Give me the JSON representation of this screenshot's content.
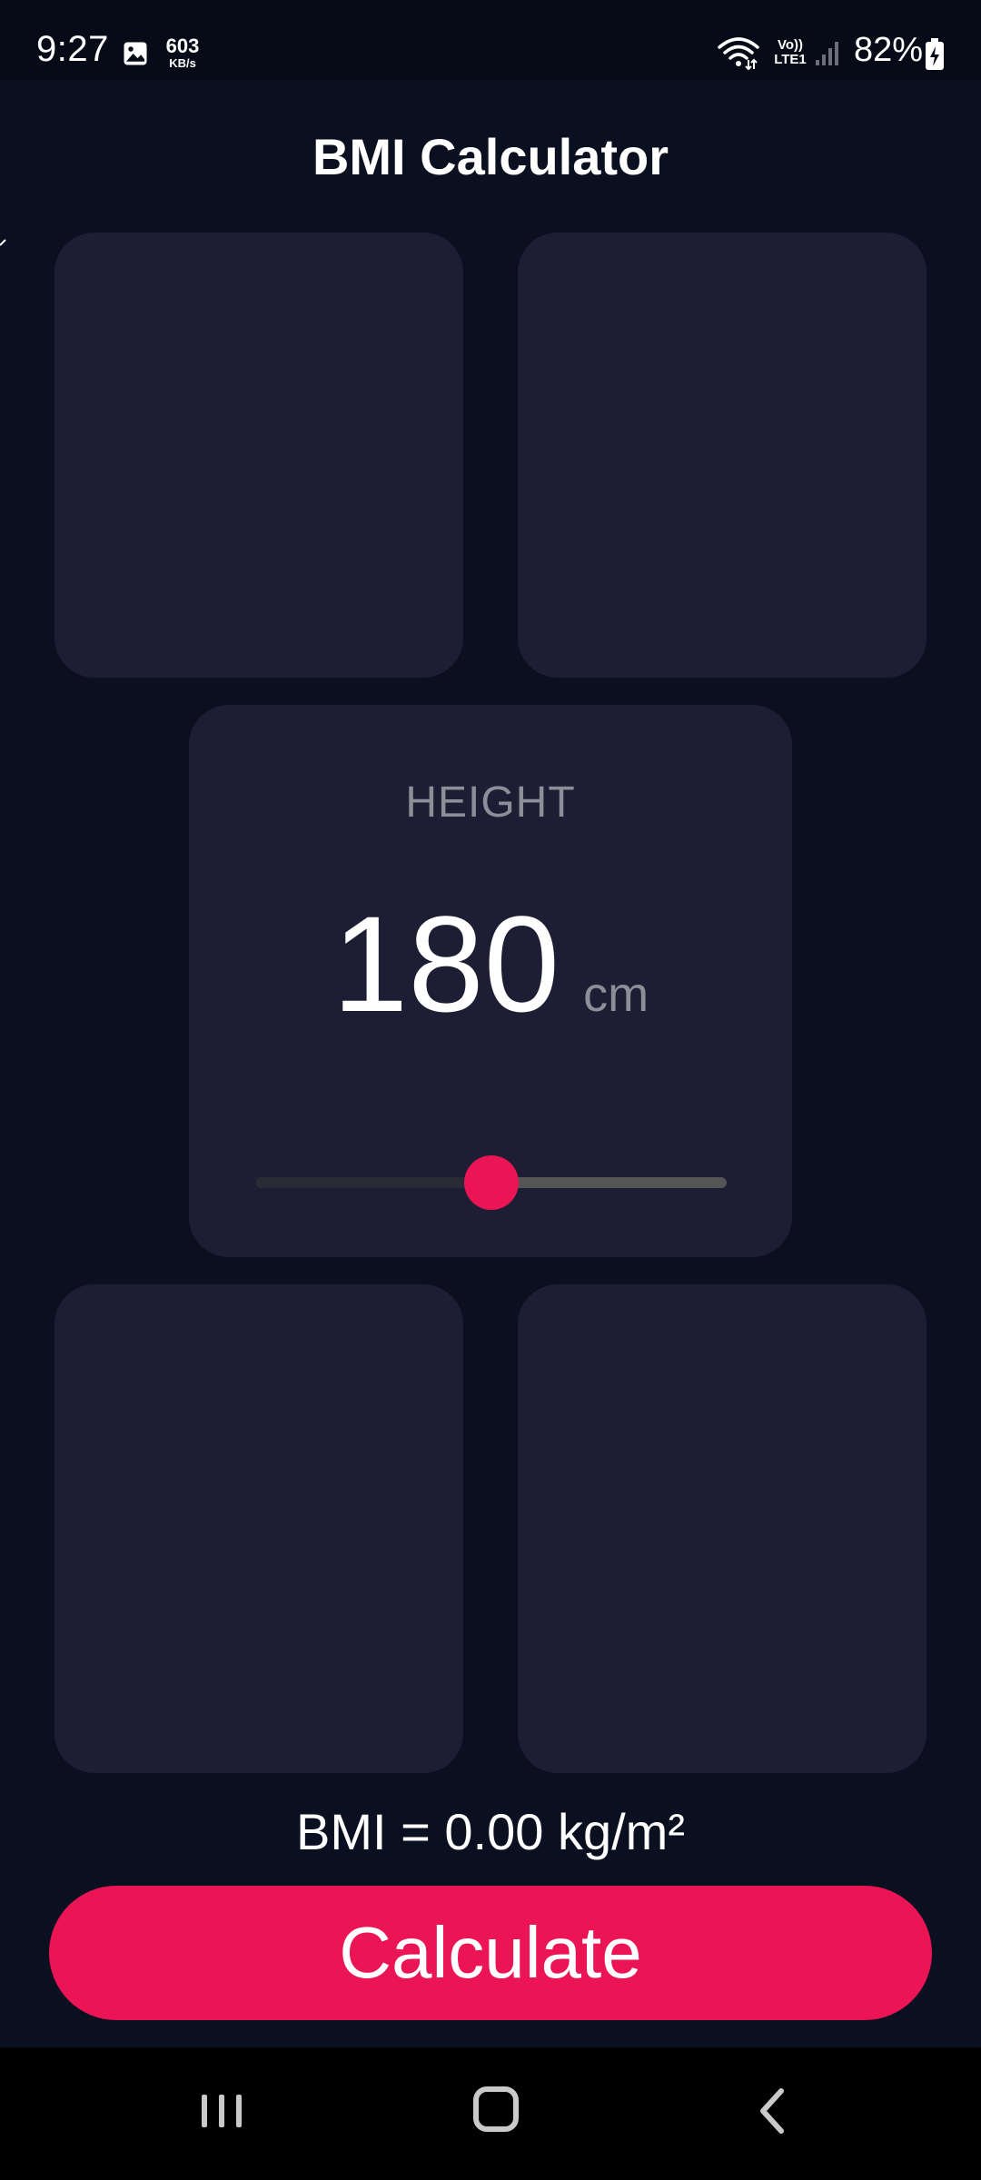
{
  "status_bar": {
    "time": "9:27",
    "net_speed_value": "603",
    "net_speed_unit": "KB/s",
    "volte_line1": "Vo))",
    "volte_line2": "LTE1",
    "battery": "82%",
    "icons": [
      "image-icon",
      "wifi-icon",
      "signal-icon",
      "battery-charging-icon"
    ]
  },
  "header": {
    "title": "BMI Calculator"
  },
  "height_card": {
    "label": "HEIGHT",
    "value": "180",
    "unit": "cm",
    "slider_fraction": 0.5
  },
  "result": {
    "text": "BMI = 0.00 kg/m²"
  },
  "actions": {
    "calculate_label": "Calculate"
  },
  "nav_bar": {
    "icons": [
      "recent-apps-icon",
      "home-icon",
      "back-icon"
    ]
  },
  "colors": {
    "background": "#0b1020",
    "card": "#1d1e33",
    "accent": "#eb1555",
    "muted_text": "#8d8e98",
    "text": "#ffffff"
  }
}
